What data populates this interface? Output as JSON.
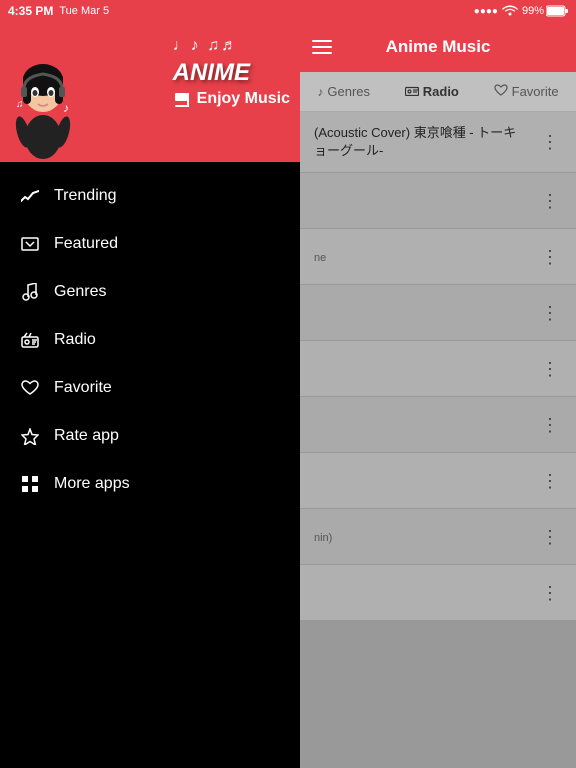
{
  "statusBar": {
    "time": "4:35 PM",
    "date": "Tue Mar 5",
    "battery": "99%",
    "signal": "●●●●",
    "wifi": "WiFi"
  },
  "app": {
    "title": "Anime Music"
  },
  "sidebar": {
    "logoLine1": "♩♪ ♫♬",
    "logoMain": "ANIME",
    "logoSub": "Enjoy Music",
    "navItems": [
      {
        "id": "trending",
        "label": "Trending",
        "icon": "trending"
      },
      {
        "id": "featured",
        "label": "Featured",
        "icon": "featured"
      },
      {
        "id": "genres",
        "label": "Genres",
        "icon": "music-note"
      },
      {
        "id": "radio",
        "label": "Radio",
        "icon": "radio"
      },
      {
        "id": "favorite",
        "label": "Favorite",
        "icon": "heart"
      },
      {
        "id": "rate-app",
        "label": "Rate app",
        "icon": "star"
      },
      {
        "id": "more-apps",
        "label": "More apps",
        "icon": "grid"
      }
    ]
  },
  "tabs": [
    {
      "id": "genres-tab",
      "label": "Genres",
      "icon": "♪"
    },
    {
      "id": "radio-tab",
      "label": "Radio",
      "icon": "📻"
    },
    {
      "id": "favorite-tab",
      "label": "Favorite",
      "icon": "♥"
    }
  ],
  "listItems": [
    {
      "title": "(Acoustic Cover) 東京喰種 - トーキョーグール-",
      "subtitle": ""
    },
    {
      "title": "",
      "subtitle": ""
    },
    {
      "title": "",
      "subtitle": "ne"
    },
    {
      "title": "",
      "subtitle": ""
    },
    {
      "title": "",
      "subtitle": ""
    },
    {
      "title": "",
      "subtitle": ""
    },
    {
      "title": "",
      "subtitle": ""
    },
    {
      "title": "",
      "subtitle": "nin)"
    },
    {
      "title": "",
      "subtitle": ""
    }
  ]
}
